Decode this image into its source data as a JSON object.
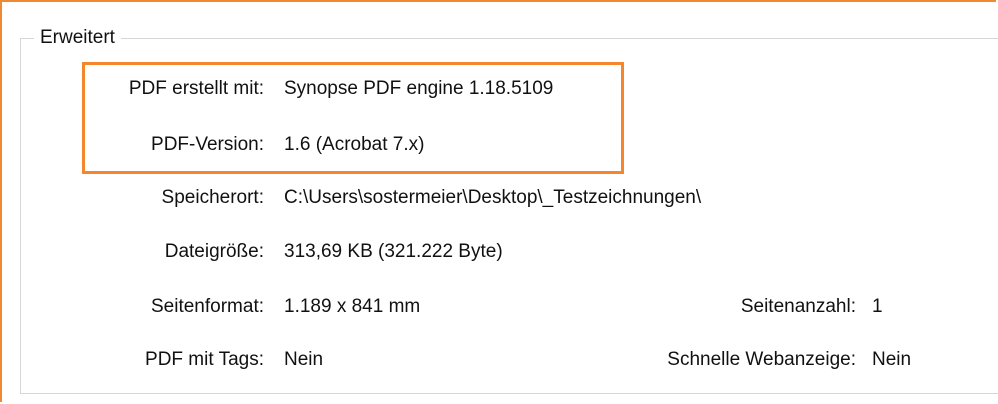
{
  "groupbox": {
    "title": "Erweitert"
  },
  "rows": {
    "pdf_creator": {
      "label": "PDF erstellt mit:",
      "value": "Synopse PDF engine 1.18.5109"
    },
    "pdf_version": {
      "label": "PDF-Version:",
      "value": "1.6 (Acrobat 7.x)"
    },
    "location": {
      "label": "Speicherort:",
      "value": "C:\\Users\\sostermeier\\Desktop\\_Testzeichnungen\\"
    },
    "file_size": {
      "label": "Dateigröße:",
      "value": "313,69 KB (321.222 Byte)"
    },
    "page_format": {
      "label": "Seitenformat:",
      "value": "1.189 x 841 mm"
    },
    "page_count": {
      "label": "Seitenanzahl:",
      "value": "1"
    },
    "tagged_pdf": {
      "label": "PDF mit Tags:",
      "value": "Nein"
    },
    "fast_web_view": {
      "label": "Schnelle Webanzeige:",
      "value": "Nein"
    }
  },
  "colors": {
    "highlight": "#f5862c",
    "frame": "#f08a32",
    "groupbox_border": "#d6d6d6"
  }
}
